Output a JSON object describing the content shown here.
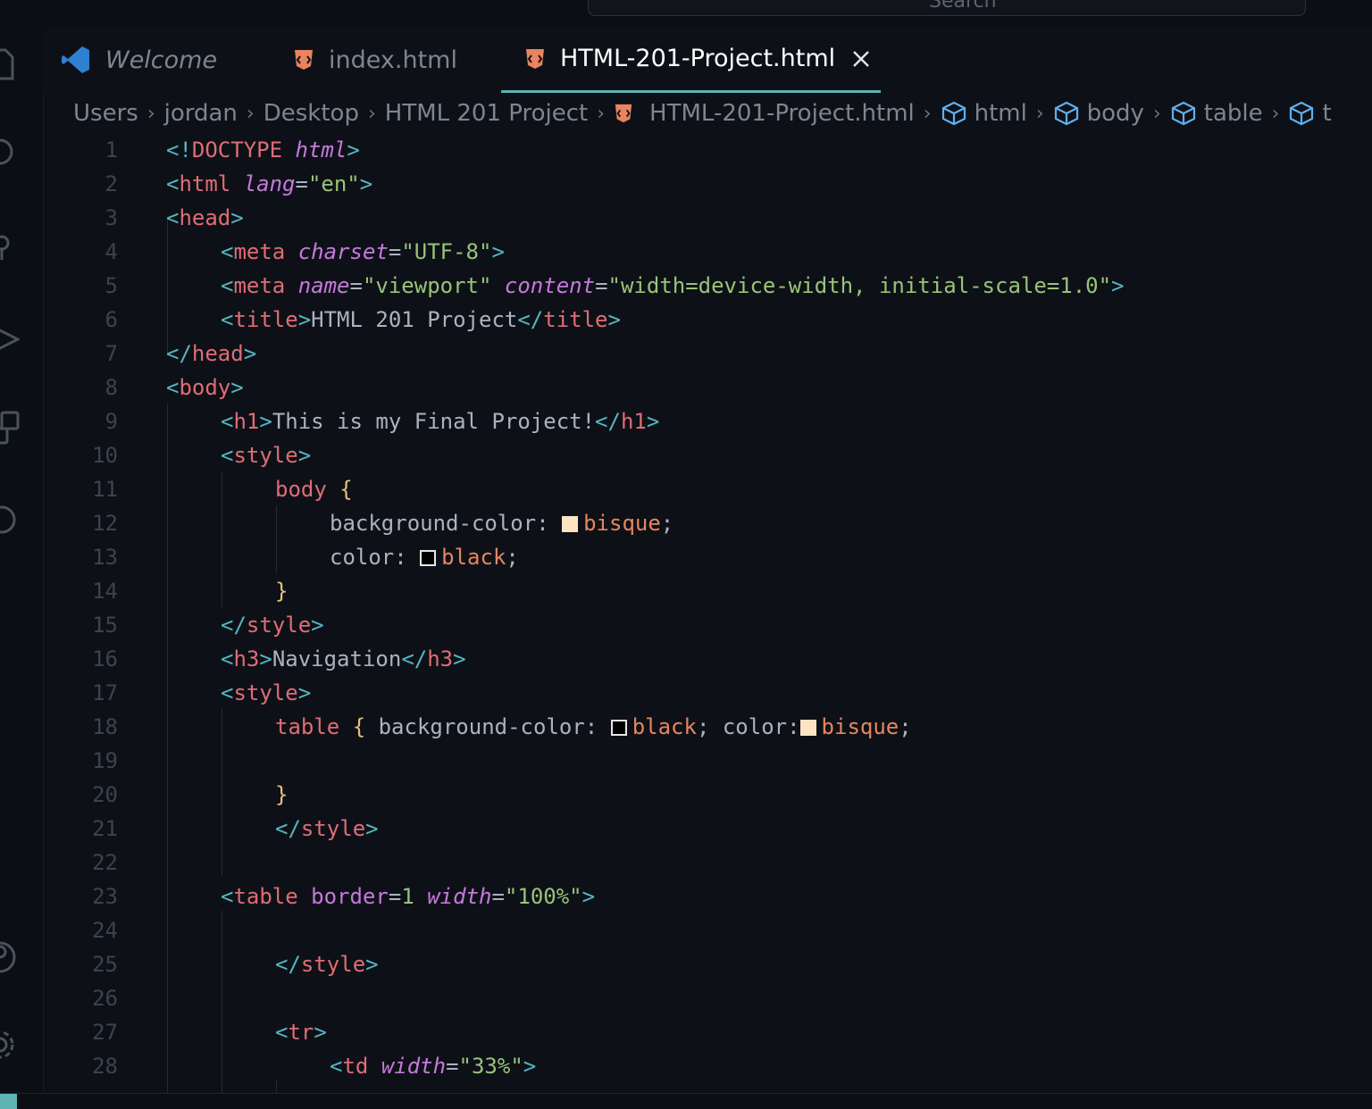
{
  "search": {
    "text": "Search"
  },
  "tabs": [
    {
      "label": "Welcome"
    },
    {
      "label": "index.html"
    },
    {
      "label": "HTML-201-Project.html"
    }
  ],
  "breadcrumb": [
    "Users",
    "jordan",
    "Desktop",
    "HTML 201 Project",
    "HTML-201-Project.html",
    "html",
    "body",
    "table",
    "t"
  ],
  "colors": {
    "bisque": "#ffe4c4",
    "black": "#000000",
    "accent": "#5fb3b3"
  },
  "code_lines": [
    {
      "n": "1",
      "indent": 0,
      "tokens": [
        [
          "p",
          "<!"
        ],
        [
          "t",
          "DOCTYPE"
        ],
        [
          "w",
          " "
        ],
        [
          "a",
          "html"
        ],
        [
          "p",
          ">"
        ]
      ]
    },
    {
      "n": "2",
      "indent": 0,
      "tokens": [
        [
          "p",
          "<"
        ],
        [
          "t",
          "html"
        ],
        [
          "w",
          " "
        ],
        [
          "a",
          "lang"
        ],
        [
          "w",
          "="
        ],
        [
          "s",
          "\"en\""
        ],
        [
          "p",
          ">"
        ]
      ]
    },
    {
      "n": "3",
      "indent": 0,
      "tokens": [
        [
          "p",
          "<"
        ],
        [
          "t",
          "head"
        ],
        [
          "p",
          ">"
        ]
      ]
    },
    {
      "n": "4",
      "indent": 1,
      "tokens": [
        [
          "p",
          "<"
        ],
        [
          "t",
          "meta"
        ],
        [
          "w",
          " "
        ],
        [
          "a",
          "charset"
        ],
        [
          "w",
          "="
        ],
        [
          "s",
          "\"UTF-8\""
        ],
        [
          "p",
          ">"
        ]
      ]
    },
    {
      "n": "5",
      "indent": 1,
      "tokens": [
        [
          "p",
          "<"
        ],
        [
          "t",
          "meta"
        ],
        [
          "w",
          " "
        ],
        [
          "a",
          "name"
        ],
        [
          "w",
          "="
        ],
        [
          "s",
          "\"viewport\""
        ],
        [
          "w",
          " "
        ],
        [
          "a",
          "content"
        ],
        [
          "w",
          "="
        ],
        [
          "s",
          "\"width=device-width, initial-scale=1.0\""
        ],
        [
          "p",
          ">"
        ]
      ]
    },
    {
      "n": "6",
      "indent": 1,
      "tokens": [
        [
          "p",
          "<"
        ],
        [
          "t",
          "title"
        ],
        [
          "p",
          ">"
        ],
        [
          "txt",
          "HTML 201 Project"
        ],
        [
          "p",
          "</"
        ],
        [
          "t",
          "title"
        ],
        [
          "p",
          ">"
        ]
      ]
    },
    {
      "n": "7",
      "indent": 0,
      "tokens": [
        [
          "p",
          "</"
        ],
        [
          "t",
          "head"
        ],
        [
          "p",
          ">"
        ]
      ]
    },
    {
      "n": "8",
      "indent": 0,
      "tokens": [
        [
          "p",
          "<"
        ],
        [
          "t",
          "body"
        ],
        [
          "p",
          ">"
        ]
      ]
    },
    {
      "n": "9",
      "indent": 1,
      "tokens": [
        [
          "p",
          "<"
        ],
        [
          "t",
          "h1"
        ],
        [
          "p",
          ">"
        ],
        [
          "txt",
          "This is my Final Project!"
        ],
        [
          "p",
          "</"
        ],
        [
          "t",
          "h1"
        ],
        [
          "p",
          ">"
        ]
      ]
    },
    {
      "n": "10",
      "indent": 1,
      "tokens": [
        [
          "p",
          "<"
        ],
        [
          "t",
          "style"
        ],
        [
          "p",
          ">"
        ]
      ]
    },
    {
      "n": "11",
      "indent": 2,
      "tokens": [
        [
          "t",
          "body"
        ],
        [
          "w",
          " "
        ],
        [
          "k",
          "{"
        ]
      ]
    },
    {
      "n": "12",
      "indent": 3,
      "tokens": [
        [
          "w",
          "background-color: "
        ],
        [
          "sw",
          "bisque"
        ],
        [
          "v",
          "bisque"
        ],
        [
          "w",
          ";"
        ]
      ]
    },
    {
      "n": "13",
      "indent": 3,
      "tokens": [
        [
          "w",
          "color: "
        ],
        [
          "sw",
          "black"
        ],
        [
          "v",
          "black"
        ],
        [
          "w",
          ";"
        ]
      ]
    },
    {
      "n": "14",
      "indent": 2,
      "tokens": [
        [
          "k",
          "}"
        ]
      ]
    },
    {
      "n": "15",
      "indent": 1,
      "tokens": [
        [
          "p",
          "</"
        ],
        [
          "t",
          "style"
        ],
        [
          "p",
          ">"
        ]
      ]
    },
    {
      "n": "16",
      "indent": 1,
      "tokens": [
        [
          "p",
          "<"
        ],
        [
          "t",
          "h3"
        ],
        [
          "p",
          ">"
        ],
        [
          "txt",
          "Navigation"
        ],
        [
          "p",
          "</"
        ],
        [
          "t",
          "h3"
        ],
        [
          "p",
          ">"
        ]
      ]
    },
    {
      "n": "17",
      "indent": 1,
      "tokens": [
        [
          "p",
          "<"
        ],
        [
          "t",
          "style"
        ],
        [
          "p",
          ">"
        ]
      ]
    },
    {
      "n": "18",
      "indent": 2,
      "tokens": [
        [
          "t",
          "table"
        ],
        [
          "w",
          " "
        ],
        [
          "k",
          "{"
        ],
        [
          "w",
          " background-color: "
        ],
        [
          "sw",
          "black"
        ],
        [
          "v",
          "black"
        ],
        [
          "w",
          "; color:"
        ],
        [
          "sw",
          "bisque"
        ],
        [
          "v",
          "bisque"
        ],
        [
          "w",
          ";"
        ]
      ]
    },
    {
      "n": "19",
      "indent": 2,
      "tokens": []
    },
    {
      "n": "20",
      "indent": 2,
      "tokens": [
        [
          "k",
          "}"
        ]
      ]
    },
    {
      "n": "21",
      "indent": 2,
      "tokens": [
        [
          "p",
          "</"
        ],
        [
          "t",
          "style"
        ],
        [
          "p",
          ">"
        ]
      ]
    },
    {
      "n": "22",
      "indent": 1,
      "tokens": []
    },
    {
      "n": "23",
      "indent": 1,
      "tokens": [
        [
          "p",
          "<"
        ],
        [
          "t",
          "table"
        ],
        [
          "w",
          " "
        ],
        [
          "an",
          "border"
        ],
        [
          "w",
          "="
        ],
        [
          "s",
          "1"
        ],
        [
          "w",
          " "
        ],
        [
          "a",
          "width"
        ],
        [
          "w",
          "="
        ],
        [
          "s",
          "\"100%\""
        ],
        [
          "p",
          ">"
        ]
      ]
    },
    {
      "n": "24",
      "indent": 1,
      "tokens": []
    },
    {
      "n": "25",
      "indent": 2,
      "tokens": [
        [
          "p",
          "</"
        ],
        [
          "t",
          "style"
        ],
        [
          "p",
          ">"
        ]
      ]
    },
    {
      "n": "26",
      "indent": 2,
      "tokens": []
    },
    {
      "n": "27",
      "indent": 2,
      "tokens": [
        [
          "p",
          "<"
        ],
        [
          "t",
          "tr"
        ],
        [
          "p",
          ">"
        ]
      ]
    },
    {
      "n": "28",
      "indent": 3,
      "tokens": [
        [
          "p",
          "<"
        ],
        [
          "t",
          "td"
        ],
        [
          "w",
          " "
        ],
        [
          "a",
          "width"
        ],
        [
          "w",
          "="
        ],
        [
          "s",
          "\"33%\""
        ],
        [
          "p",
          ">"
        ]
      ]
    }
  ]
}
